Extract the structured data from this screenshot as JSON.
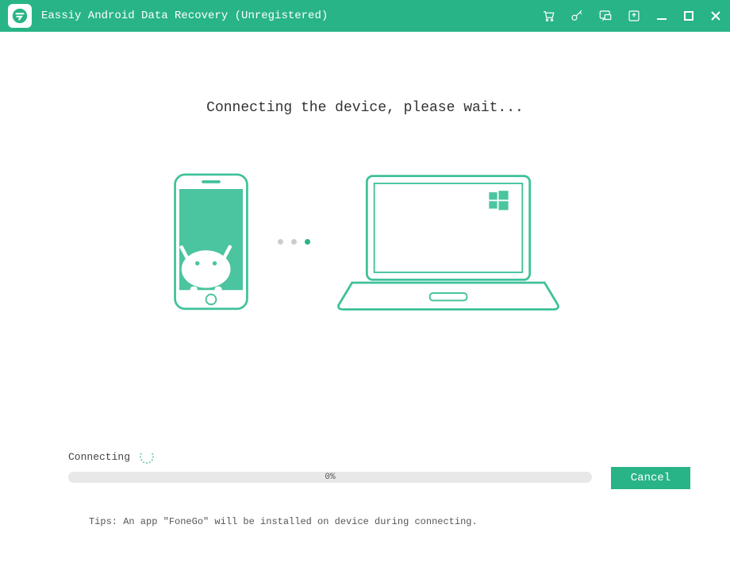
{
  "titlebar": {
    "title": "Eassiy Android Data Recovery (Unregistered)"
  },
  "main": {
    "headline": "Connecting the device, please wait...",
    "status_label": "Connecting",
    "progress_text": "0%",
    "cancel_label": "Cancel",
    "tips": "Tips: An app \"FoneGo\" will be installed on device during connecting."
  },
  "icons": {
    "cart": "cart-icon",
    "key": "key-icon",
    "feedback": "feedback-icon",
    "update": "update-icon",
    "minimize": "minimize-icon",
    "maximize": "maximize-icon",
    "close": "close-icon"
  }
}
